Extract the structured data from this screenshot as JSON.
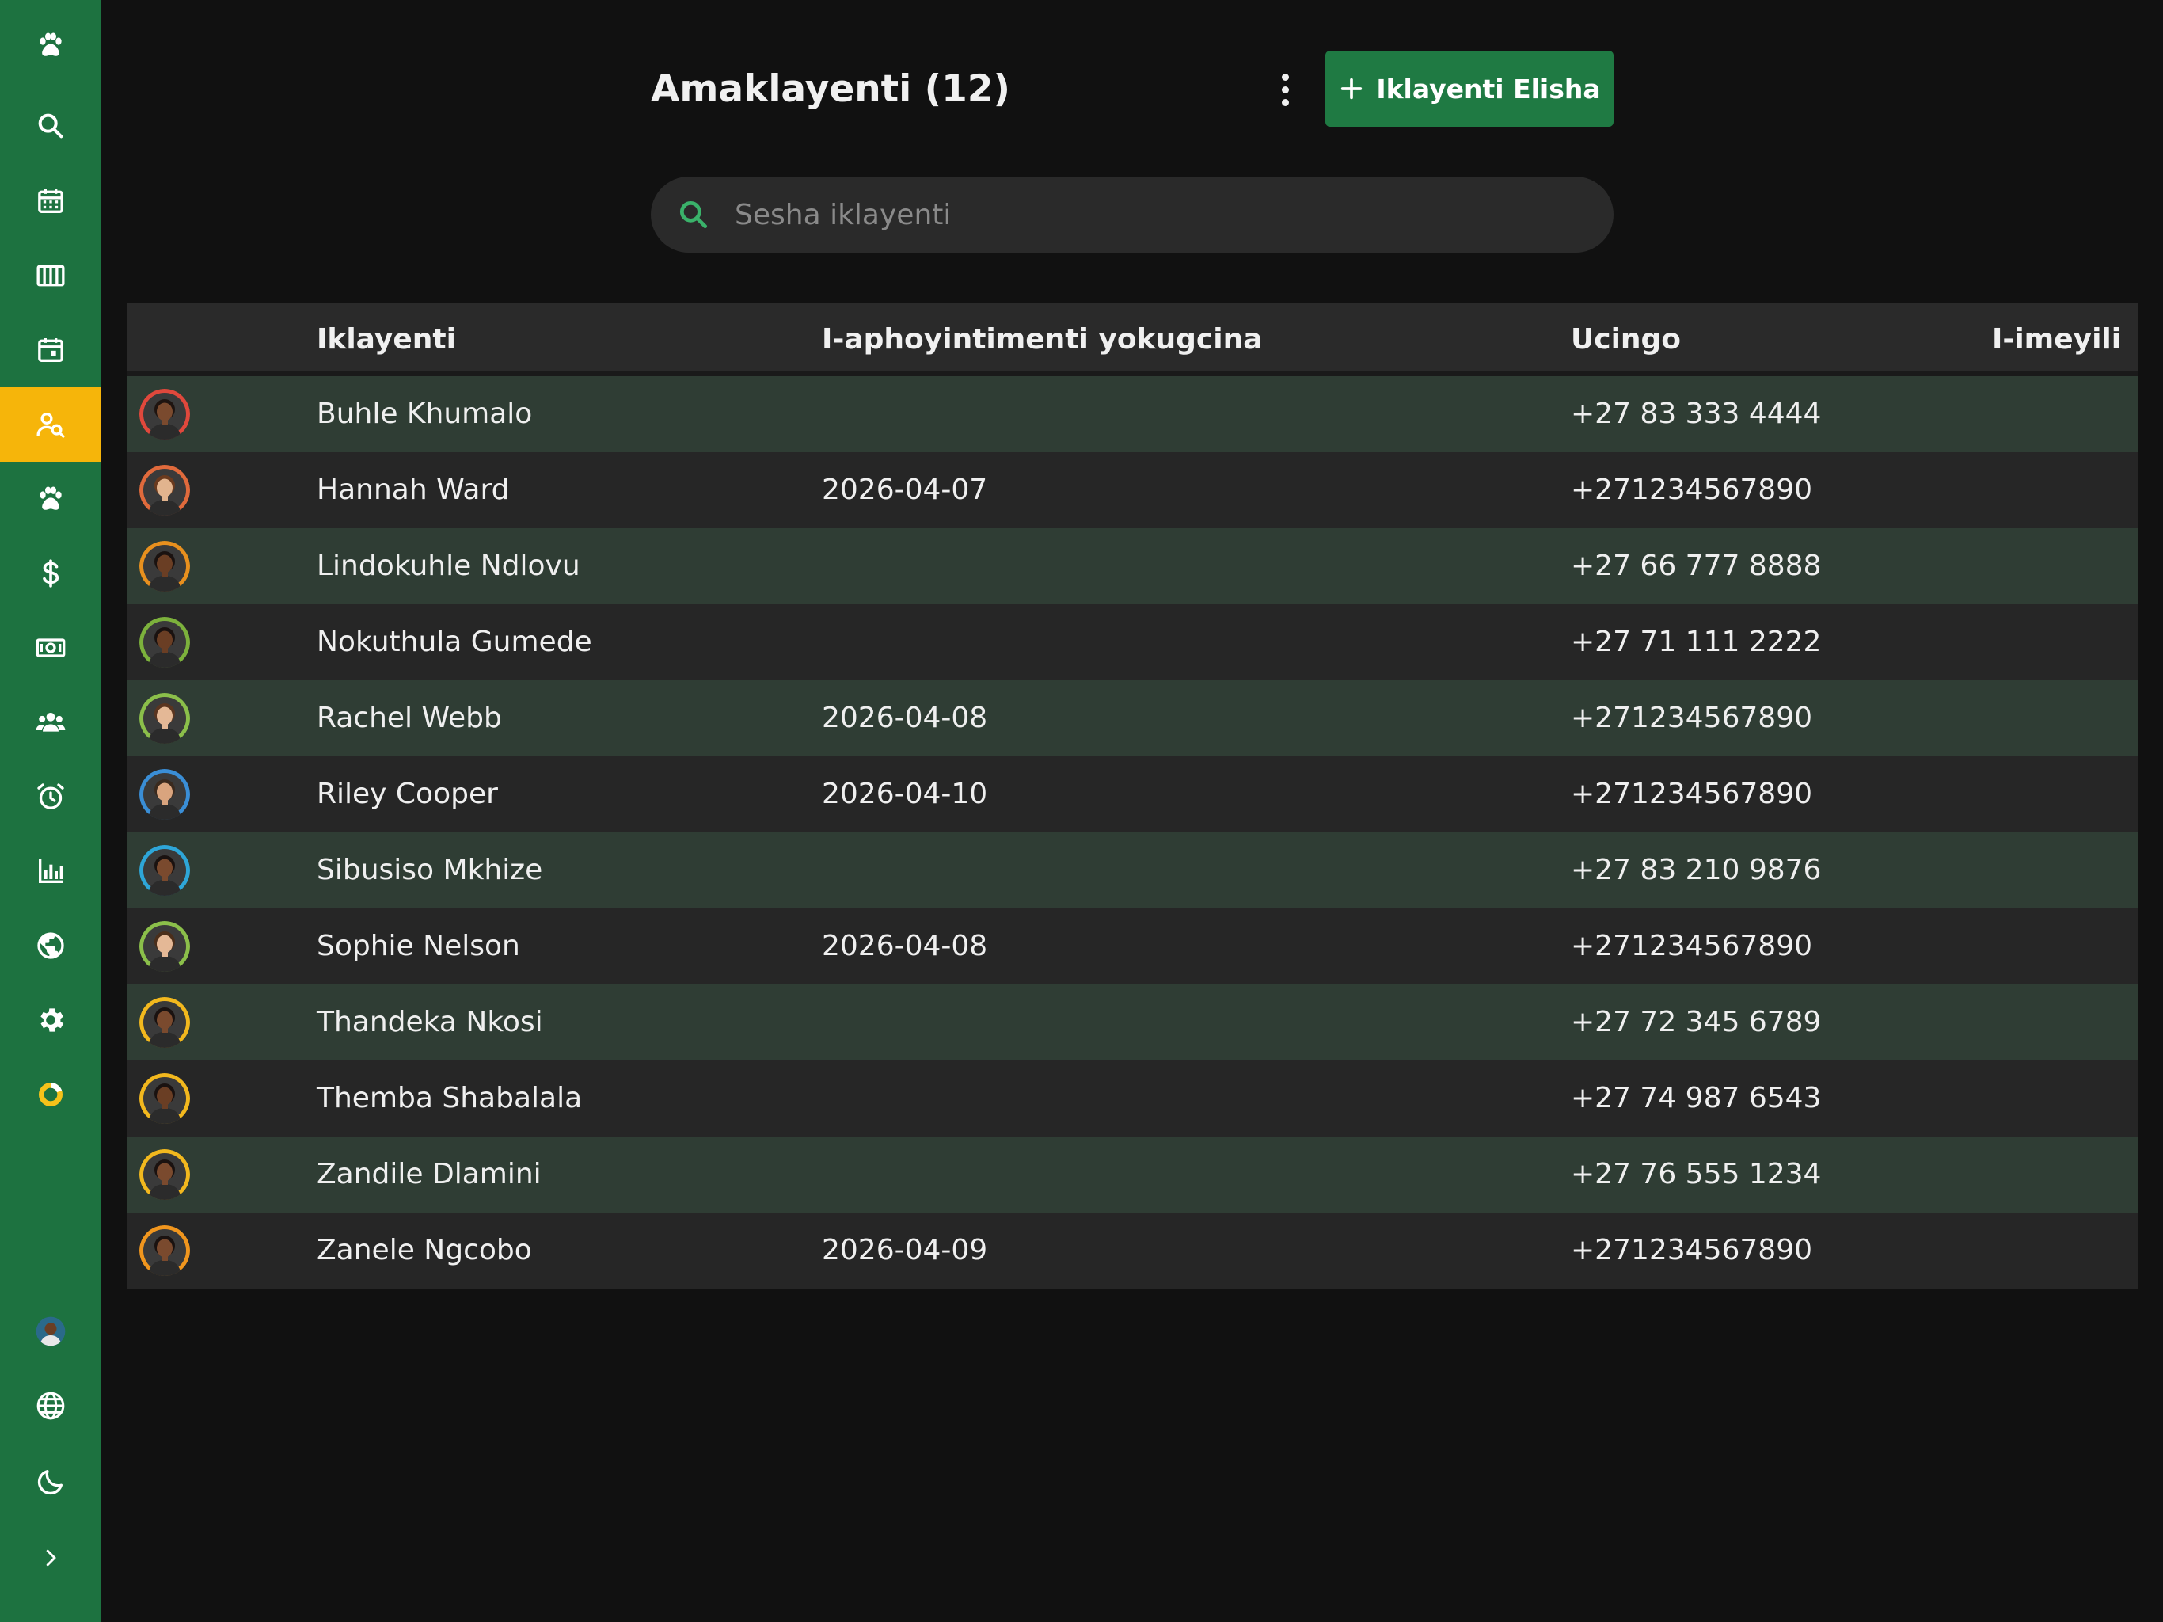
{
  "app": {
    "sidebar": {
      "top_items": [
        {
          "name": "paw-logo-icon",
          "active": false
        },
        {
          "name": "search-icon",
          "active": false
        },
        {
          "name": "calendar-icon",
          "active": false
        },
        {
          "name": "kennels-grid-icon",
          "active": false
        },
        {
          "name": "calendar-day-icon",
          "active": false
        },
        {
          "name": "client-search-icon",
          "active": true
        },
        {
          "name": "paw-icon",
          "active": false
        },
        {
          "name": "dollar-icon",
          "active": false
        },
        {
          "name": "cash-icon",
          "active": false
        },
        {
          "name": "users-icon",
          "active": false
        },
        {
          "name": "alarm-clock-icon",
          "active": false
        },
        {
          "name": "bar-chart-icon",
          "active": false
        },
        {
          "name": "globe-icon",
          "active": false
        },
        {
          "name": "gear-icon",
          "active": false
        },
        {
          "name": "ring-progress-icon",
          "active": false
        }
      ],
      "bottom_items": [
        {
          "name": "user-avatar"
        },
        {
          "name": "language-globe-icon"
        },
        {
          "name": "dark-mode-moon-icon"
        },
        {
          "name": "expand-chevron-right-icon"
        }
      ],
      "colors": {
        "background": "#1d7240",
        "active": "#f6b50a"
      }
    },
    "header": {
      "title": "Amaklayenti (12)",
      "add_button_label": "Iklayenti Elisha",
      "search_placeholder": "Sesha iklayenti"
    },
    "table": {
      "columns": [
        "Iklayenti",
        "I-aphoyintimenti yokugcina",
        "Ucingo",
        "I-imeyili"
      ],
      "rows": [
        {
          "name": "Buhle Khumalo",
          "last_appointment": "",
          "phone": "+27 83 333 4444",
          "email": "",
          "avatar_ring": "#e0483c",
          "skin": "#7a4a2e",
          "hair": "#1e1410"
        },
        {
          "name": "Hannah Ward",
          "last_appointment": "2026-04-07",
          "phone": "+271234567890",
          "email": "",
          "avatar_ring": "#e06a3c",
          "skin": "#e2b48e",
          "hair": "#6a3a1e"
        },
        {
          "name": "Lindokuhle Ndlovu",
          "last_appointment": "",
          "phone": "+27 66 777 8888",
          "email": "",
          "avatar_ring": "#e8901e",
          "skin": "#6a3e24",
          "hair": "#1a1210"
        },
        {
          "name": "Nokuthula Gumede",
          "last_appointment": "",
          "phone": "+27 71 111 2222",
          "email": "",
          "avatar_ring": "#7cb13c",
          "skin": "#6a3e24",
          "hair": "#1a1210"
        },
        {
          "name": "Rachel Webb",
          "last_appointment": "2026-04-08",
          "phone": "+271234567890",
          "email": "",
          "avatar_ring": "#8bbf4a",
          "skin": "#e4b896",
          "hair": "#5a3520"
        },
        {
          "name": "Riley Cooper",
          "last_appointment": "2026-04-10",
          "phone": "+271234567890",
          "email": "",
          "avatar_ring": "#3a8ed6",
          "skin": "#d9a47e",
          "hair": "#3a2a1e"
        },
        {
          "name": "Sibusiso Mkhize",
          "last_appointment": "",
          "phone": "+27 83 210 9876",
          "email": "",
          "avatar_ring": "#2ea6d8",
          "skin": "#7a4a2e",
          "hair": "#1a1210"
        },
        {
          "name": "Sophie Nelson",
          "last_appointment": "2026-04-08",
          "phone": "+271234567890",
          "email": "",
          "avatar_ring": "#8bbf4a",
          "skin": "#e4b896",
          "hair": "#4a2e1a"
        },
        {
          "name": "Thandeka Nkosi",
          "last_appointment": "",
          "phone": "+27 72 345 6789",
          "email": "",
          "avatar_ring": "#f2b81e",
          "skin": "#7a4a2e",
          "hair": "#1a1210"
        },
        {
          "name": "Themba Shabalala",
          "last_appointment": "",
          "phone": "+27 74 987 6543",
          "email": "",
          "avatar_ring": "#f2b81e",
          "skin": "#6a3e24",
          "hair": "#1a1210"
        },
        {
          "name": "Zandile Dlamini",
          "last_appointment": "",
          "phone": "+27 76 555 1234",
          "email": "",
          "avatar_ring": "#f2b81e",
          "skin": "#7a4a2e",
          "hair": "#1a1210"
        },
        {
          "name": "Zanele Ngcobo",
          "last_appointment": "2026-04-09",
          "phone": "+271234567890",
          "email": "",
          "avatar_ring": "#f0961e",
          "skin": "#7a4a2e",
          "hair": "#1a1210"
        }
      ]
    },
    "colors": {
      "accent_green": "#1f7a43",
      "search_icon": "#3ab26a",
      "row_odd": "#2f3d34",
      "row_even": "#262626"
    }
  }
}
